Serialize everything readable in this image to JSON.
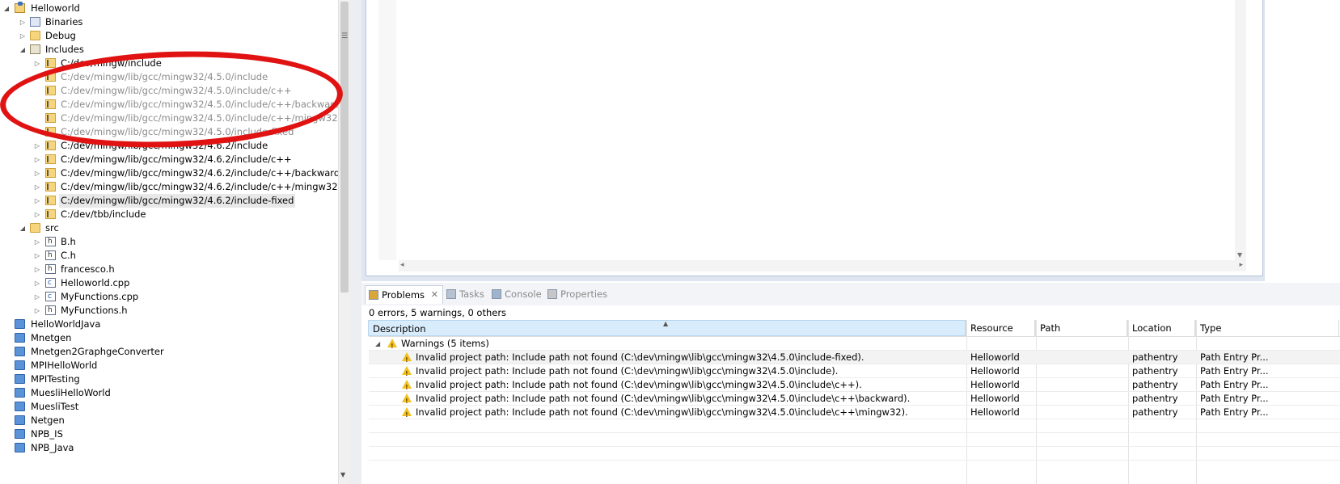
{
  "tree": {
    "items": [
      {
        "label": "Helloworld",
        "icon": "project-icon",
        "twisty": "expanded",
        "level": 0,
        "kind": "project"
      },
      {
        "label": "Binaries",
        "icon": "binaries-icon",
        "twisty": "collapsed",
        "level": 1,
        "kind": "bin"
      },
      {
        "label": "Debug",
        "icon": "folder-icon",
        "twisty": "collapsed",
        "level": 1,
        "kind": "fold"
      },
      {
        "label": "Includes",
        "icon": "includes-icon",
        "twisty": "expanded",
        "level": 1,
        "kind": "inc"
      },
      {
        "label": "C:/dev/mingw/include",
        "icon": "include-folder-icon",
        "twisty": "collapsed",
        "level": 2,
        "kind": "incfold"
      },
      {
        "label": "C:/dev/mingw/lib/gcc/mingw32/4.5.0/include",
        "icon": "include-folder-icon",
        "twisty": "",
        "level": 2,
        "kind": "incfold",
        "grey": true
      },
      {
        "label": "C:/dev/mingw/lib/gcc/mingw32/4.5.0/include/c++",
        "icon": "include-folder-icon",
        "twisty": "",
        "level": 2,
        "kind": "incfold",
        "grey": true
      },
      {
        "label": "C:/dev/mingw/lib/gcc/mingw32/4.5.0/include/c++/backward",
        "icon": "include-folder-icon",
        "twisty": "",
        "level": 2,
        "kind": "incfold",
        "grey": true
      },
      {
        "label": "C:/dev/mingw/lib/gcc/mingw32/4.5.0/include/c++/mingw32",
        "icon": "include-folder-icon",
        "twisty": "",
        "level": 2,
        "kind": "incfold",
        "grey": true
      },
      {
        "label": "C:/dev/mingw/lib/gcc/mingw32/4.5.0/include-fixed",
        "icon": "include-folder-icon",
        "twisty": "",
        "level": 2,
        "kind": "incfold",
        "grey": true
      },
      {
        "label": "C:/dev/mingw/lib/gcc/mingw32/4.6.2/include",
        "icon": "include-folder-icon",
        "twisty": "collapsed",
        "level": 2,
        "kind": "incfold"
      },
      {
        "label": "C:/dev/mingw/lib/gcc/mingw32/4.6.2/include/c++",
        "icon": "include-folder-icon",
        "twisty": "collapsed",
        "level": 2,
        "kind": "incfold"
      },
      {
        "label": "C:/dev/mingw/lib/gcc/mingw32/4.6.2/include/c++/backward",
        "icon": "include-folder-icon",
        "twisty": "collapsed",
        "level": 2,
        "kind": "incfold"
      },
      {
        "label": "C:/dev/mingw/lib/gcc/mingw32/4.6.2/include/c++/mingw32",
        "icon": "include-folder-icon",
        "twisty": "collapsed",
        "level": 2,
        "kind": "incfold"
      },
      {
        "label": "C:/dev/mingw/lib/gcc/mingw32/4.6.2/include-fixed",
        "icon": "include-folder-icon",
        "twisty": "collapsed",
        "level": 2,
        "kind": "incfold",
        "selected": true
      },
      {
        "label": "C:/dev/tbb/include",
        "icon": "include-folder-icon",
        "twisty": "collapsed",
        "level": 2,
        "kind": "incfold"
      },
      {
        "label": "src",
        "icon": "source-folder-icon",
        "twisty": "expanded",
        "level": 1,
        "kind": "fold"
      },
      {
        "label": "B.h",
        "icon": "header-file-icon",
        "twisty": "collapsed",
        "level": 2,
        "kind": "h"
      },
      {
        "label": "C.h",
        "icon": "header-file-icon",
        "twisty": "collapsed",
        "level": 2,
        "kind": "h"
      },
      {
        "label": "francesco.h",
        "icon": "header-file-icon",
        "twisty": "collapsed",
        "level": 2,
        "kind": "h"
      },
      {
        "label": "Helloworld.cpp",
        "icon": "cpp-file-icon",
        "twisty": "collapsed",
        "level": 2,
        "kind": "c"
      },
      {
        "label": "MyFunctions.cpp",
        "icon": "cpp-file-icon",
        "twisty": "collapsed",
        "level": 2,
        "kind": "c"
      },
      {
        "label": "MyFunctions.h",
        "icon": "header-file-icon",
        "twisty": "collapsed",
        "level": 2,
        "kind": "h"
      },
      {
        "label": "HelloWorldJava",
        "icon": "closed-project-icon",
        "twisty": "",
        "level": 0,
        "kind": "blue"
      },
      {
        "label": "Mnetgen",
        "icon": "closed-project-icon",
        "twisty": "",
        "level": 0,
        "kind": "blue"
      },
      {
        "label": "Mnetgen2GraphgeConverter",
        "icon": "closed-project-icon",
        "twisty": "",
        "level": 0,
        "kind": "blue"
      },
      {
        "label": "MPIHelloWorld",
        "icon": "closed-project-icon",
        "twisty": "",
        "level": 0,
        "kind": "blue"
      },
      {
        "label": "MPITesting",
        "icon": "closed-project-icon",
        "twisty": "",
        "level": 0,
        "kind": "blue"
      },
      {
        "label": "MuesliHelloWorld",
        "icon": "closed-project-icon",
        "twisty": "",
        "level": 0,
        "kind": "blue"
      },
      {
        "label": "MuesliTest",
        "icon": "closed-project-icon",
        "twisty": "",
        "level": 0,
        "kind": "blue"
      },
      {
        "label": "Netgen",
        "icon": "closed-project-icon",
        "twisty": "",
        "level": 0,
        "kind": "blue"
      },
      {
        "label": "NPB_IS",
        "icon": "closed-project-icon",
        "twisty": "",
        "level": 0,
        "kind": "blue"
      },
      {
        "label": "NPB_Java",
        "icon": "closed-project-icon",
        "twisty": "",
        "level": 0,
        "kind": "blue"
      }
    ]
  },
  "annotation": {
    "color": "#e01212"
  },
  "problems": {
    "tabs": [
      {
        "label": "Problems",
        "icon": "problems-icon",
        "active": true
      },
      {
        "label": "Tasks",
        "icon": "tasks-icon",
        "active": false
      },
      {
        "label": "Console",
        "icon": "console-icon",
        "active": false
      },
      {
        "label": "Properties",
        "icon": "properties-icon",
        "active": false
      }
    ],
    "summary": "0 errors, 5 warnings, 0 others",
    "columns": [
      "Description",
      "Resource",
      "Path",
      "Location",
      "Type"
    ],
    "group": "Warnings (5 items)",
    "rows": [
      {
        "description": "Invalid project path: Include path not found (C:\\dev\\mingw\\lib\\gcc\\mingw32\\4.5.0\\include-fixed).",
        "resource": "Helloworld",
        "path": "",
        "location": "pathentry",
        "type": "Path Entry Pr..."
      },
      {
        "description": "Invalid project path: Include path not found (C:\\dev\\mingw\\lib\\gcc\\mingw32\\4.5.0\\include).",
        "resource": "Helloworld",
        "path": "",
        "location": "pathentry",
        "type": "Path Entry Pr..."
      },
      {
        "description": "Invalid project path: Include path not found (C:\\dev\\mingw\\lib\\gcc\\mingw32\\4.5.0\\include\\c++).",
        "resource": "Helloworld",
        "path": "",
        "location": "pathentry",
        "type": "Path Entry Pr..."
      },
      {
        "description": "Invalid project path: Include path not found (C:\\dev\\mingw\\lib\\gcc\\mingw32\\4.5.0\\include\\c++\\backward).",
        "resource": "Helloworld",
        "path": "",
        "location": "pathentry",
        "type": "Path Entry Pr..."
      },
      {
        "description": "Invalid project path: Include path not found (C:\\dev\\mingw\\lib\\gcc\\mingw32\\4.5.0\\include\\c++\\mingw32).",
        "resource": "Helloworld",
        "path": "",
        "location": "pathentry",
        "type": "Path Entry Pr..."
      }
    ]
  },
  "colors": {
    "accent": "#d9ecfb",
    "warning": "#f2c01e",
    "greyed_text": "#8c8c8c"
  }
}
